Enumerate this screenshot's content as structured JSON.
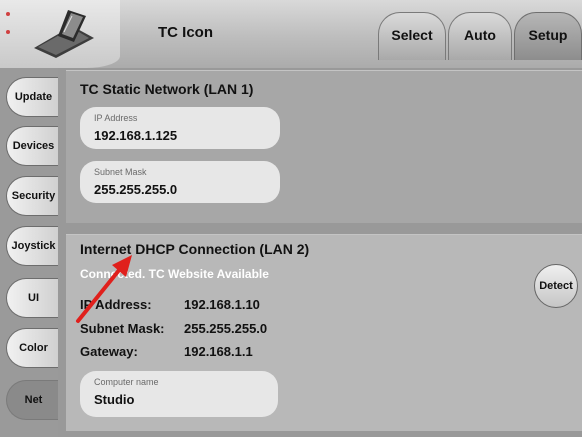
{
  "header": {
    "title": "TC Icon",
    "tabs": [
      {
        "label": "Select"
      },
      {
        "label": "Auto"
      },
      {
        "label": "Setup",
        "active": true
      }
    ]
  },
  "sidebar": {
    "items": [
      {
        "label": "Update"
      },
      {
        "label": "Devices"
      },
      {
        "label": "Security"
      },
      {
        "label": "Joystick"
      },
      {
        "label": "UI"
      },
      {
        "label": "Color"
      },
      {
        "label": "Net",
        "active": true
      }
    ]
  },
  "lan1": {
    "title": "TC Static Network (LAN 1)",
    "ip_label": "IP Address",
    "ip_value": "192.168.1.125",
    "mask_label": "Subnet Mask",
    "mask_value": "255.255.255.0"
  },
  "lan2": {
    "title": "Internet DHCP Connection (LAN 2)",
    "status": "Connected. TC Website Available",
    "ip_label": "IP Address:",
    "ip_value": "192.168.1.10",
    "mask_label": "Subnet Mask:",
    "mask_value": "255.255.255.0",
    "gateway_label": "Gateway:",
    "gateway_value": "192.168.1.1",
    "computer_name_label": "Computer name",
    "computer_name_value": "Studio",
    "detect_label": "Detect"
  },
  "colors": {
    "annotation_arrow": "#e0201c",
    "status_text": "#ffffff"
  },
  "icons": [
    "touch-panel-device-icon",
    "annotation-arrow"
  ]
}
